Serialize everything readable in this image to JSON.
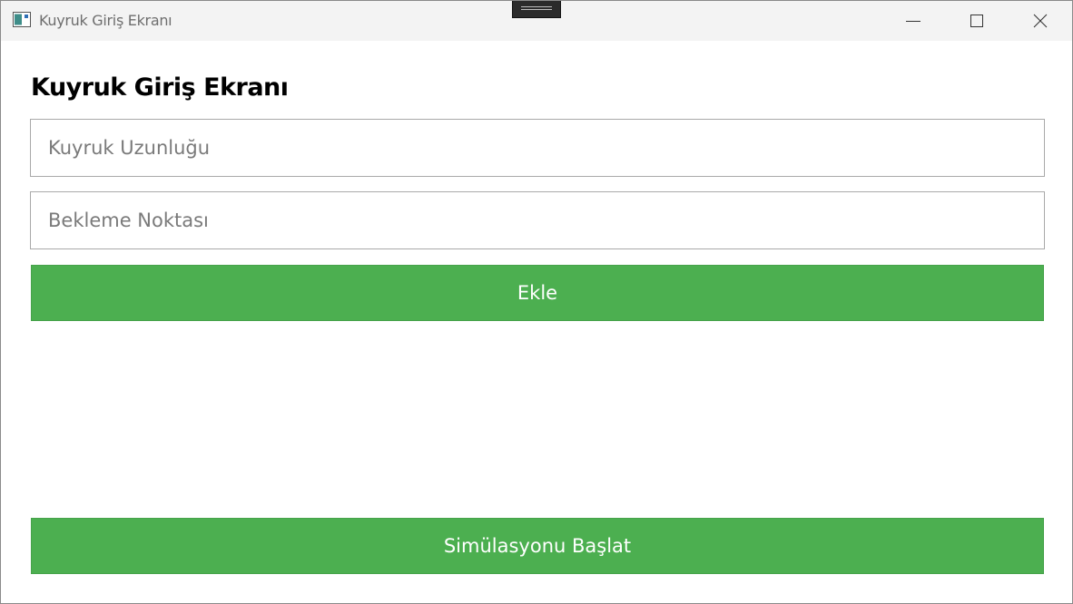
{
  "window": {
    "title": "Kuyruk Giriş Ekranı",
    "icon": "app-window-icon",
    "controls": {
      "minimize_icon": "minimize-icon",
      "maximize_icon": "maximize-icon",
      "close_icon": "close-icon"
    }
  },
  "form": {
    "heading": "Kuyruk Giriş Ekranı",
    "queue_length": {
      "placeholder": "Kuyruk Uzunluğu",
      "value": ""
    },
    "wait_point": {
      "placeholder": "Bekleme Noktası",
      "value": ""
    },
    "add_button_label": "Ekle",
    "start_button_label": "Simülasyonu Başlat"
  },
  "colors": {
    "button_green": "#4caf50",
    "button_text": "#ffffff",
    "titlebar_bg": "#f3f3f3"
  }
}
